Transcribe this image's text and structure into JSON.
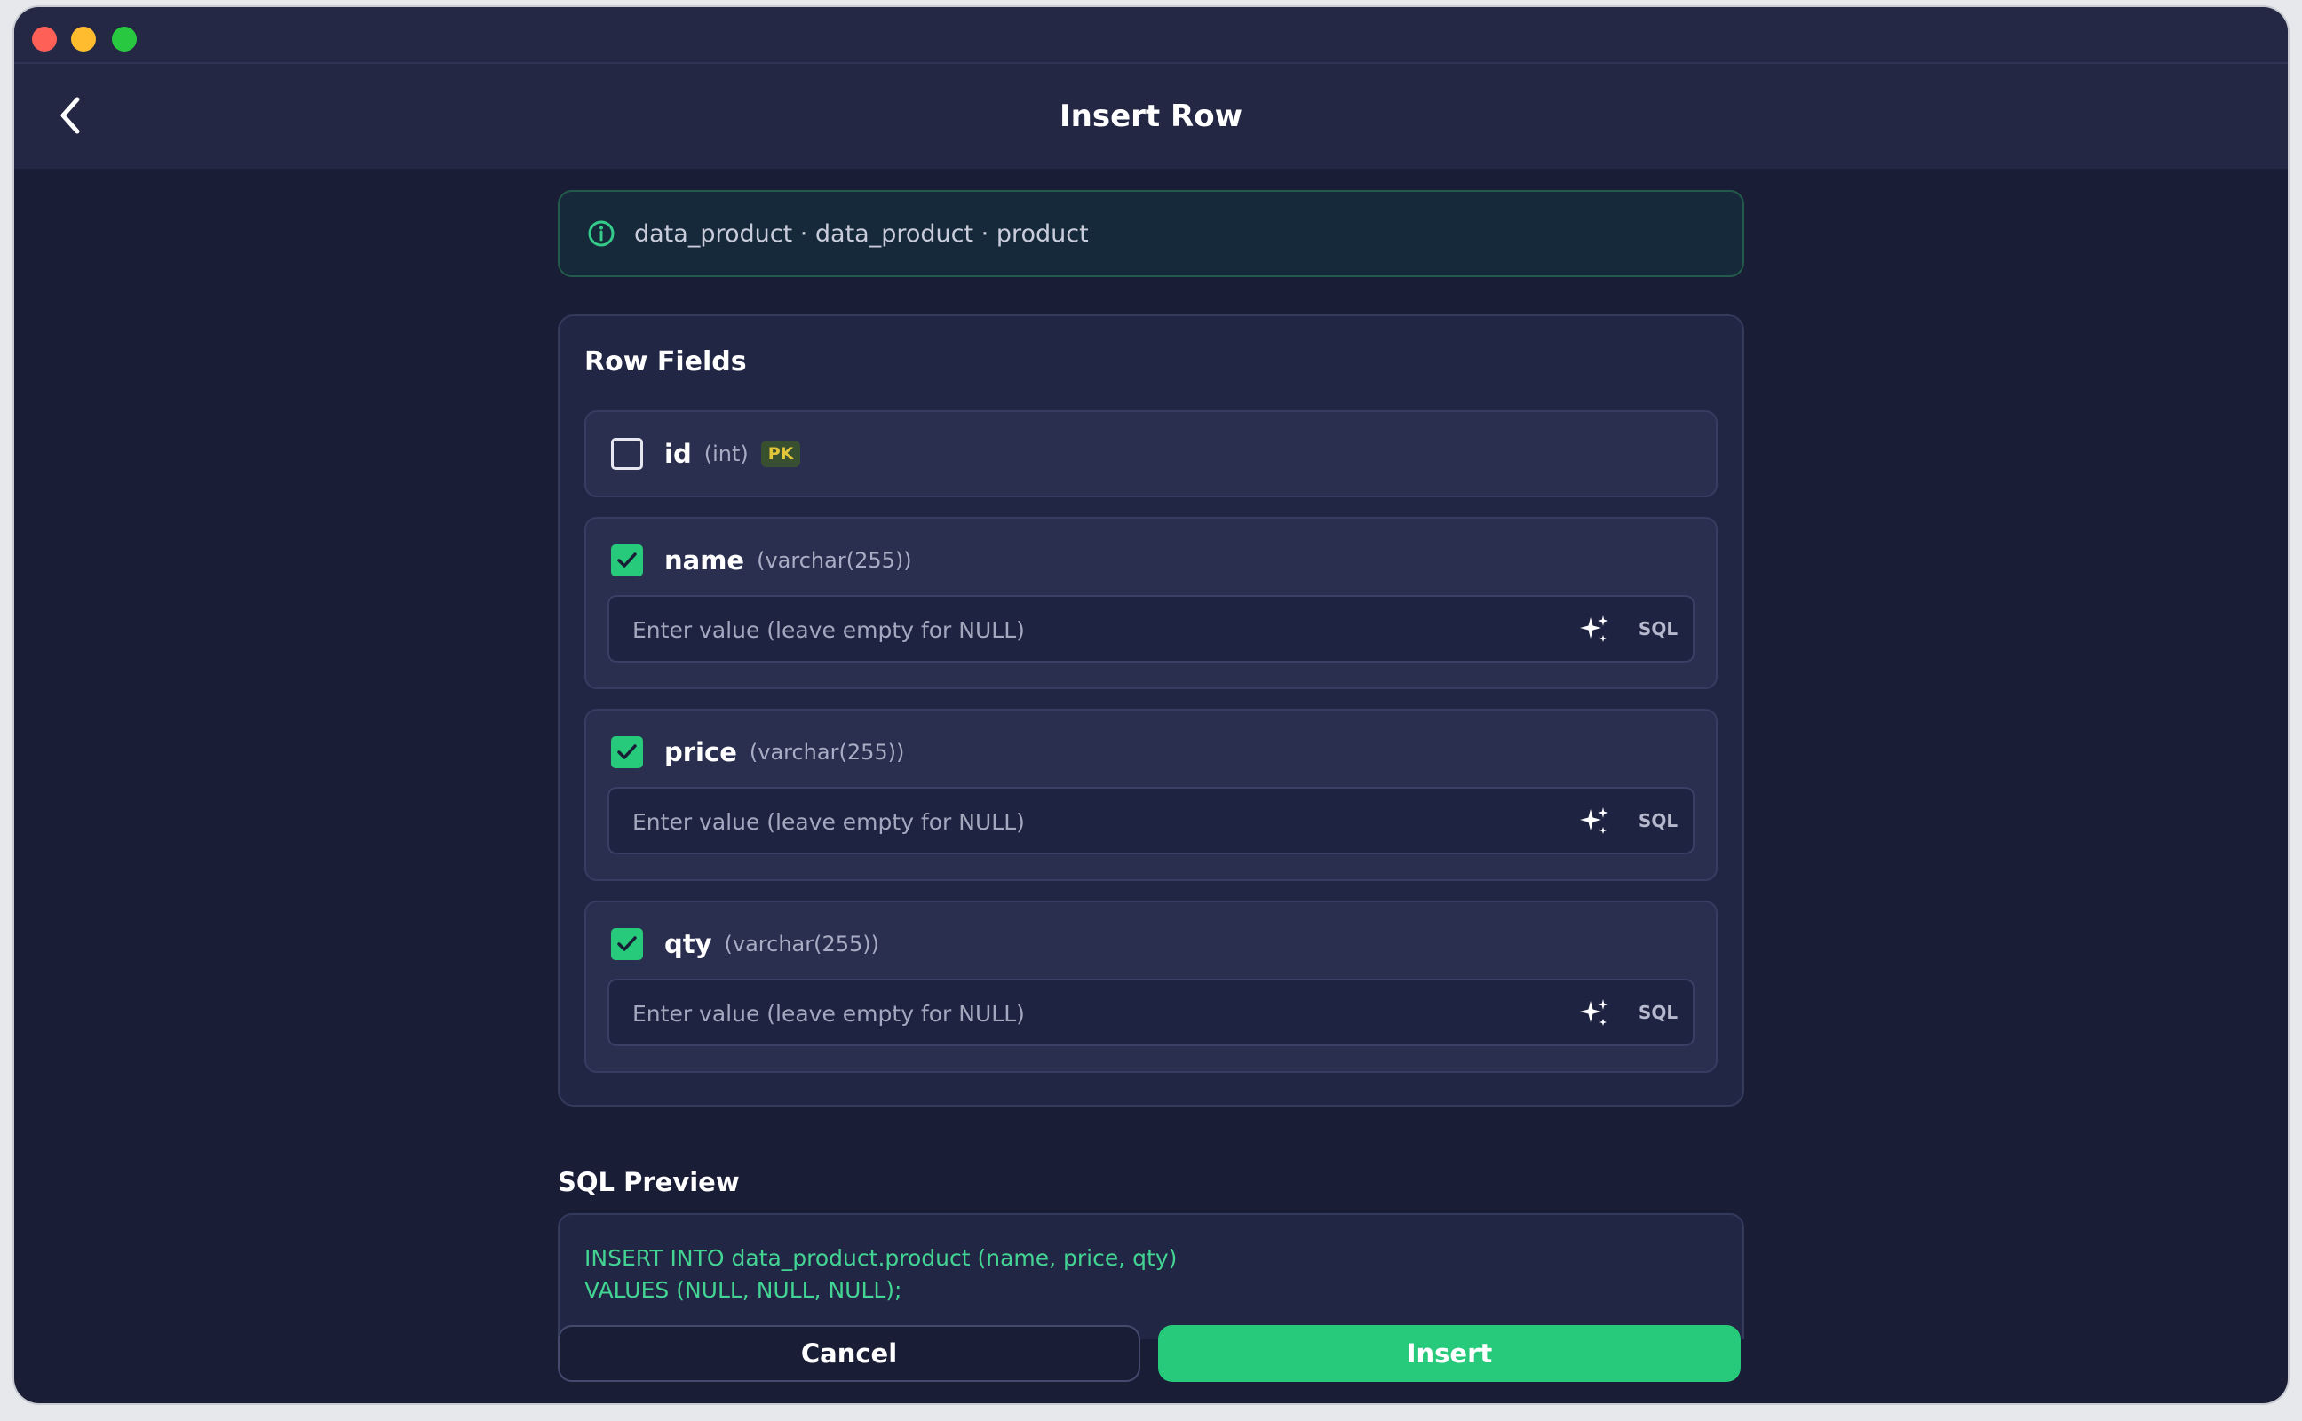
{
  "header": {
    "title": "Insert Row"
  },
  "banner": {
    "path": "data_product · data_product · product"
  },
  "row_fields": {
    "title": "Row Fields",
    "fields": [
      {
        "name": "id",
        "type": "(int)",
        "badge": "PK",
        "checked": false
      },
      {
        "name": "name",
        "type": "(varchar(255))",
        "checked": true,
        "placeholder": "Enter value (leave empty for NULL)",
        "sql_label": "SQL"
      },
      {
        "name": "price",
        "type": "(varchar(255))",
        "checked": true,
        "placeholder": "Enter value (leave empty for NULL)",
        "sql_label": "SQL"
      },
      {
        "name": "qty",
        "type": "(varchar(255))",
        "checked": true,
        "placeholder": "Enter value (leave empty for NULL)",
        "sql_label": "SQL"
      }
    ]
  },
  "sql_preview": {
    "title": "SQL Preview",
    "line1": "INSERT INTO data_product.product (name, price, qty)",
    "line2": "VALUES (NULL, NULL, NULL);"
  },
  "actions": {
    "cancel_label": "Cancel",
    "insert_label": "Insert"
  },
  "colors": {
    "accent": "#27c97b",
    "background": "#1a1d36",
    "panel": "#222645",
    "pk_badge_text": "#e2c53a"
  }
}
